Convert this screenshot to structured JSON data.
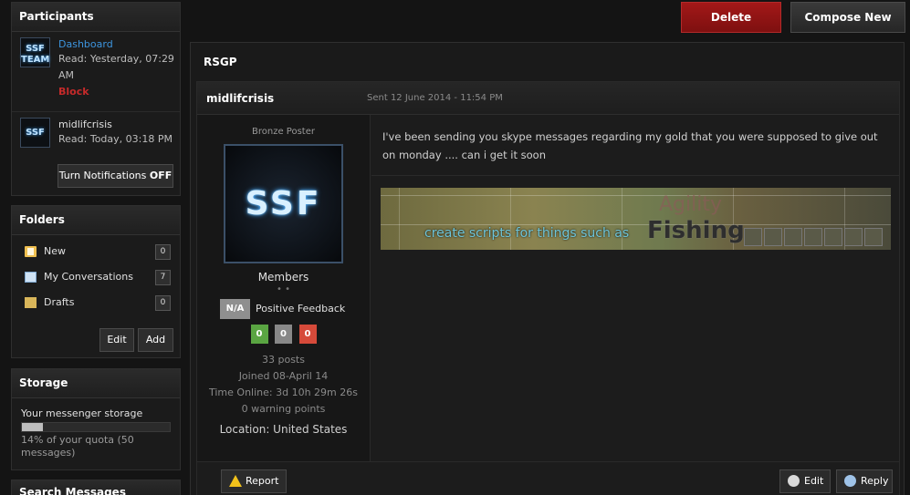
{
  "sidebar": {
    "participants": {
      "title": "Participants",
      "items": [
        {
          "avatar": "SSF TEAM",
          "name": "Dashboard",
          "read": "Read: Yesterday, 07:29 AM",
          "action": "Block"
        },
        {
          "avatar": "SSF",
          "name": "midlifcrisis",
          "read": "Read: Today, 03:18 PM"
        }
      ],
      "notifications_prefix": "Turn Notifications",
      "notifications_state": "OFF"
    },
    "folders": {
      "title": "Folders",
      "items": [
        {
          "label": "New",
          "count": "0",
          "icon": "document-icon"
        },
        {
          "label": "My Conversations",
          "count": "7",
          "icon": "mail-icon"
        },
        {
          "label": "Drafts",
          "count": "0",
          "icon": "drafts-icon"
        }
      ],
      "edit_label": "Edit",
      "add_label": "Add"
    },
    "storage": {
      "title": "Storage",
      "label": "Your messenger storage",
      "used_fraction": 0.14,
      "quota_text": "14% of your quota (50 messages)"
    },
    "search": {
      "title": "Search Messages"
    }
  },
  "toolbar": {
    "delete_label": "Delete",
    "compose_label": "Compose New"
  },
  "conversation": {
    "title": "RSGP",
    "post": {
      "author": "midlifcrisis",
      "sent": "Sent 12 June 2014 - 11:54 PM",
      "rank": "Bronze Poster",
      "avatar_text": "SSF",
      "group": "Members",
      "group_dots": "• •",
      "feedback_badge": "N/A",
      "feedback_label": "Positive Feedback",
      "feedback_counts": {
        "positive": "0",
        "neutral": "0",
        "negative": "0"
      },
      "posts": "33 posts",
      "joined": "Joined 08-April 14",
      "time_online": "Time Online: 3d 10h 29m 26s",
      "warnings": "0 warning points",
      "location": "Location: United States",
      "message": "I've been sending you skype messages regarding my gold that you were supposed to give out on monday .... can i get it soon",
      "signature": {
        "text": "create scripts for things such as",
        "highlight": "Fishing",
        "faded": "Agility"
      },
      "report_label": "Report",
      "edit_label": "Edit",
      "reply_label": "Reply"
    }
  },
  "colors": {
    "accent_link": "#3d95df",
    "delete": "#9a1515",
    "block": "#c62a2a",
    "fb_pos": "#5aa542",
    "fb_neg": "#d64a3a"
  }
}
